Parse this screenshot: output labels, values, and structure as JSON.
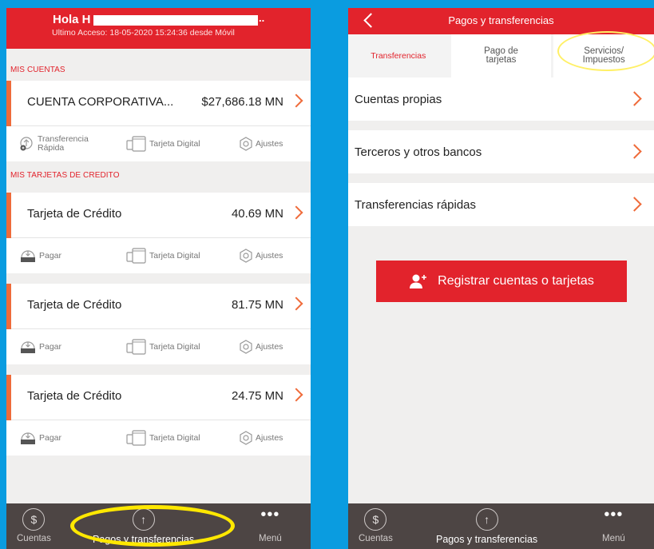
{
  "left": {
    "header": {
      "greeting": "Hola H",
      "ellipsis": "..",
      "last_access": "Ultimo Acceso: 18-05-2020 15:24:36 desde Móvil"
    },
    "accounts_section": "MIS CUENTAS",
    "account": {
      "name": "CUENTA CORPORATIVA...",
      "amount": "$27,686.18 MN",
      "actions": [
        "Transferencia",
        "Rápida",
        "Tarjeta Digital",
        "Ajustes"
      ]
    },
    "cards_section": "MIS TARJETAS DE CREDITO",
    "cards": [
      {
        "name": "Tarjeta de Crédito",
        "amount": "40.69 MN",
        "actions": [
          "Pagar",
          "Tarjeta Digital",
          "Ajustes"
        ]
      },
      {
        "name": "Tarjeta de Crédito",
        "amount": "81.75 MN",
        "actions": [
          "Pagar",
          "Tarjeta Digital",
          "Ajustes"
        ]
      },
      {
        "name": "Tarjeta de Crédito",
        "amount": "24.75 MN",
        "actions": [
          "Pagar",
          "Tarjeta Digital",
          "Ajustes"
        ]
      }
    ]
  },
  "nav": {
    "cuentas": "Cuentas",
    "pagos": "Pagos y transferencias",
    "menu": "Menú",
    "cuentas_icon": "$",
    "pagos_icon": "↑",
    "menu_icon": "•••"
  },
  "right": {
    "title": "Pagos y transferencias",
    "tabs": [
      {
        "line1": "Transferencias",
        "line2": ""
      },
      {
        "line1": "Pago de",
        "line2": "tarjetas"
      },
      {
        "line1": "Servicios/",
        "line2": "Impuestos"
      }
    ],
    "rows": [
      "Cuentas propias",
      "Terceros y otros bancos",
      "Transferencias rápidas"
    ],
    "register_button": "Registrar cuentas o tarjetas"
  },
  "colors": {
    "brand_red": "#e2232c",
    "accent_orange": "#ef6b3a",
    "background_blue": "#0a9ce0",
    "highlight_yellow": "#ffe800",
    "nav_bg": "#4d4544"
  }
}
